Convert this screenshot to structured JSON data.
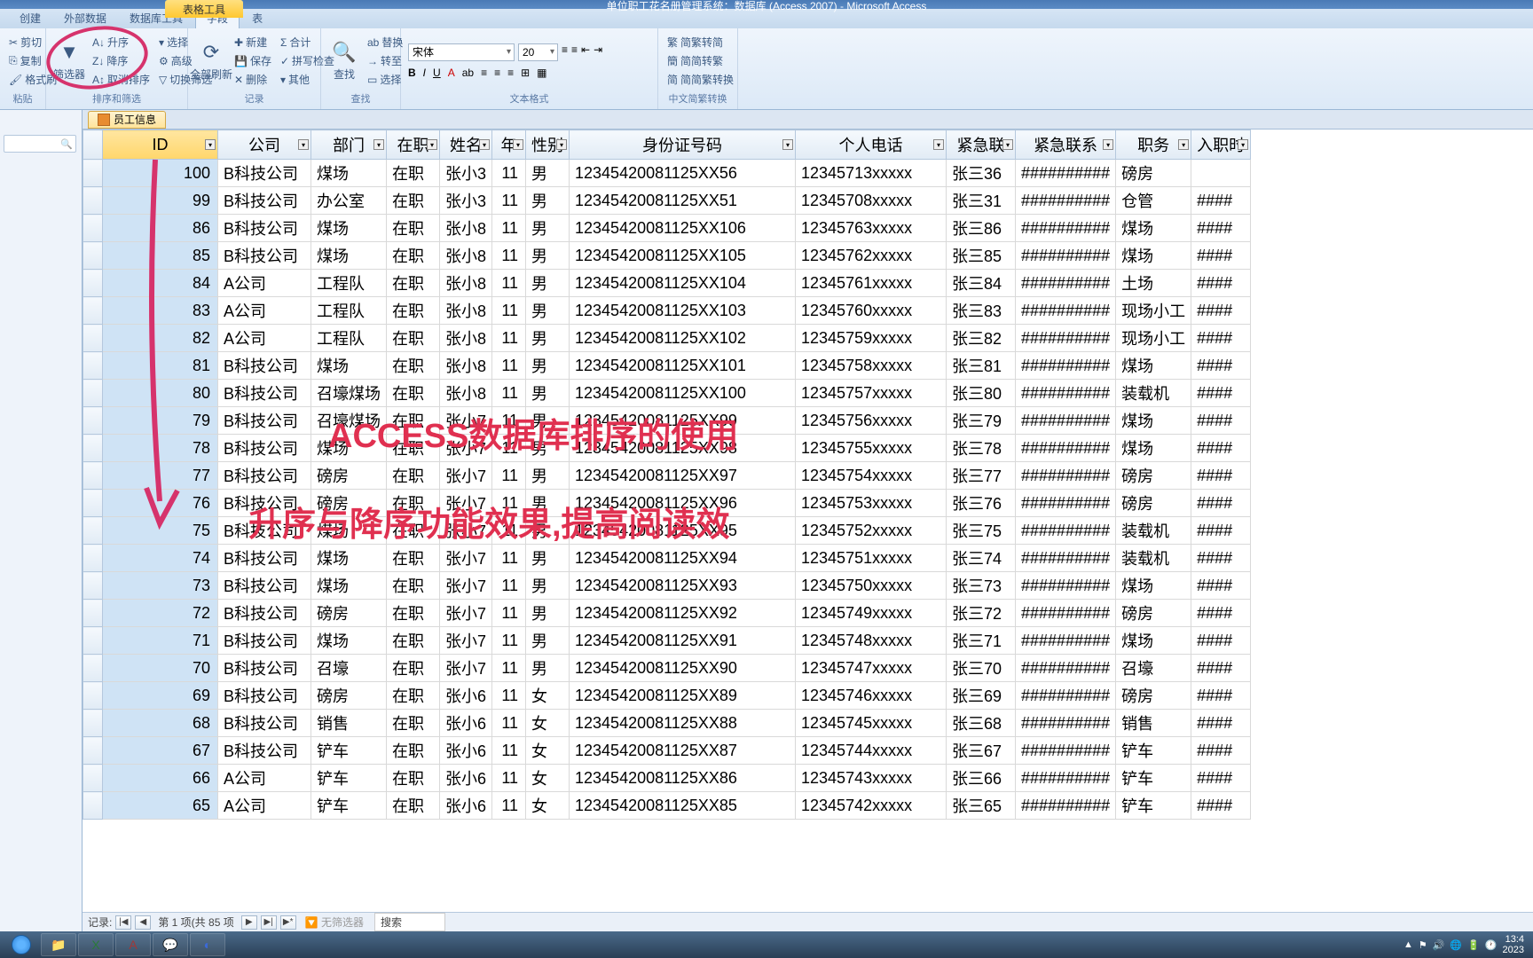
{
  "window": {
    "title": "单位职工花名册管理系统：数据库 (Access 2007) - Microsoft Access",
    "context_tab": "表格工具"
  },
  "ribbon_tabs": {
    "create": "创建",
    "external": "外部数据",
    "dbtools": "数据库工具",
    "fields": "字段",
    "table": "表"
  },
  "ribbon": {
    "clipboard": {
      "cut": "剪切",
      "copy": "复制",
      "format": "格式刷",
      "label": "粘贴"
    },
    "sort": {
      "asc": "升序",
      "desc": "降序",
      "clear": "取消排序",
      "filter": "筛选器",
      "select": "选择",
      "advanced": "高级",
      "toggle": "切换筛选",
      "label": "排序和筛选"
    },
    "records": {
      "refresh": "全部刷新",
      "new": "新建",
      "save": "保存",
      "delete": "删除",
      "totals": "合计",
      "spell": "拼写检查",
      "more": "其他",
      "label": "记录"
    },
    "find": {
      "find": "查找",
      "replace": "替换",
      "goto": "转至",
      "select": "选择",
      "label": "查找"
    },
    "textfmt": {
      "font": "宋体",
      "size": "20",
      "label": "文本格式"
    },
    "chs": {
      "a": "简繁转简",
      "b": "简简转繁",
      "c": "简简繁转换",
      "label": "中文简繁转换"
    }
  },
  "doc_tab": {
    "label": "员工信息"
  },
  "columns": {
    "id": "ID",
    "company": "公司",
    "dept": "部门",
    "status": "在职",
    "name": "姓名",
    "age": "年",
    "gender": "性别",
    "idcard": "身份证号码",
    "phone": "个人电话",
    "emerg": "紧急联",
    "emerg2": "紧急联系",
    "job": "职务",
    "hire": "入职时"
  },
  "rows": [
    {
      "id": 100,
      "company": "B科技公司",
      "dept": "煤场",
      "status": "在职",
      "name": "张小3",
      "age": 11,
      "gender": "男",
      "idcard": "12345420081125XX56",
      "phone": "12345713xxxxx",
      "emerg": "张三36",
      "job": "磅房",
      "h": ""
    },
    {
      "id": 99,
      "company": "B科技公司",
      "dept": "办公室",
      "status": "在职",
      "name": "张小3",
      "age": 11,
      "gender": "男",
      "idcard": "12345420081125XX51",
      "phone": "12345708xxxxx",
      "emerg": "张三31",
      "job": "仓管",
      "h": "####"
    },
    {
      "id": 86,
      "company": "B科技公司",
      "dept": "煤场",
      "status": "在职",
      "name": "张小8",
      "age": 11,
      "gender": "男",
      "idcard": "12345420081125XX106",
      "phone": "12345763xxxxx",
      "emerg": "张三86",
      "job": "煤场",
      "h": "####"
    },
    {
      "id": 85,
      "company": "B科技公司",
      "dept": "煤场",
      "status": "在职",
      "name": "张小8",
      "age": 11,
      "gender": "男",
      "idcard": "12345420081125XX105",
      "phone": "12345762xxxxx",
      "emerg": "张三85",
      "job": "煤场",
      "h": "####"
    },
    {
      "id": 84,
      "company": "A公司",
      "dept": "工程队",
      "status": "在职",
      "name": "张小8",
      "age": 11,
      "gender": "男",
      "idcard": "12345420081125XX104",
      "phone": "12345761xxxxx",
      "emerg": "张三84",
      "job": "土场",
      "h": "####"
    },
    {
      "id": 83,
      "company": "A公司",
      "dept": "工程队",
      "status": "在职",
      "name": "张小8",
      "age": 11,
      "gender": "男",
      "idcard": "12345420081125XX103",
      "phone": "12345760xxxxx",
      "emerg": "张三83",
      "job": "现场小工",
      "h": "####"
    },
    {
      "id": 82,
      "company": "A公司",
      "dept": "工程队",
      "status": "在职",
      "name": "张小8",
      "age": 11,
      "gender": "男",
      "idcard": "12345420081125XX102",
      "phone": "12345759xxxxx",
      "emerg": "张三82",
      "job": "现场小工",
      "h": "####"
    },
    {
      "id": 81,
      "company": "B科技公司",
      "dept": "煤场",
      "status": "在职",
      "name": "张小8",
      "age": 11,
      "gender": "男",
      "idcard": "12345420081125XX101",
      "phone": "12345758xxxxx",
      "emerg": "张三81",
      "job": "煤场",
      "h": "####"
    },
    {
      "id": 80,
      "company": "B科技公司",
      "dept": "召壕煤场",
      "status": "在职",
      "name": "张小8",
      "age": 11,
      "gender": "男",
      "idcard": "12345420081125XX100",
      "phone": "12345757xxxxx",
      "emerg": "张三80",
      "job": "装载机",
      "h": "####"
    },
    {
      "id": 79,
      "company": "B科技公司",
      "dept": "召壕煤场",
      "status": "在职",
      "name": "张小7",
      "age": 11,
      "gender": "男",
      "idcard": "12345420081125XX99",
      "phone": "12345756xxxxx",
      "emerg": "张三79",
      "job": "煤场",
      "h": "####"
    },
    {
      "id": 78,
      "company": "B科技公司",
      "dept": "煤场",
      "status": "在职",
      "name": "张小7",
      "age": 11,
      "gender": "男",
      "idcard": "12345420081125XX98",
      "phone": "12345755xxxxx",
      "emerg": "张三78",
      "job": "煤场",
      "h": "####"
    },
    {
      "id": 77,
      "company": "B科技公司",
      "dept": "磅房",
      "status": "在职",
      "name": "张小7",
      "age": 11,
      "gender": "男",
      "idcard": "12345420081125XX97",
      "phone": "12345754xxxxx",
      "emerg": "张三77",
      "job": "磅房",
      "h": "####"
    },
    {
      "id": 76,
      "company": "B科技公司",
      "dept": "磅房",
      "status": "在职",
      "name": "张小7",
      "age": 11,
      "gender": "男",
      "idcard": "12345420081125XX96",
      "phone": "12345753xxxxx",
      "emerg": "张三76",
      "job": "磅房",
      "h": "####"
    },
    {
      "id": 75,
      "company": "B科技公司",
      "dept": "煤场",
      "status": "在职",
      "name": "张小7",
      "age": 11,
      "gender": "男",
      "idcard": "12345420081125XX95",
      "phone": "12345752xxxxx",
      "emerg": "张三75",
      "job": "装载机",
      "h": "####"
    },
    {
      "id": 74,
      "company": "B科技公司",
      "dept": "煤场",
      "status": "在职",
      "name": "张小7",
      "age": 11,
      "gender": "男",
      "idcard": "12345420081125XX94",
      "phone": "12345751xxxxx",
      "emerg": "张三74",
      "job": "装载机",
      "h": "####"
    },
    {
      "id": 73,
      "company": "B科技公司",
      "dept": "煤场",
      "status": "在职",
      "name": "张小7",
      "age": 11,
      "gender": "男",
      "idcard": "12345420081125XX93",
      "phone": "12345750xxxxx",
      "emerg": "张三73",
      "job": "煤场",
      "h": "####"
    },
    {
      "id": 72,
      "company": "B科技公司",
      "dept": "磅房",
      "status": "在职",
      "name": "张小7",
      "age": 11,
      "gender": "男",
      "idcard": "12345420081125XX92",
      "phone": "12345749xxxxx",
      "emerg": "张三72",
      "job": "磅房",
      "h": "####"
    },
    {
      "id": 71,
      "company": "B科技公司",
      "dept": "煤场",
      "status": "在职",
      "name": "张小7",
      "age": 11,
      "gender": "男",
      "idcard": "12345420081125XX91",
      "phone": "12345748xxxxx",
      "emerg": "张三71",
      "job": "煤场",
      "h": "####"
    },
    {
      "id": 70,
      "company": "B科技公司",
      "dept": "召壕",
      "status": "在职",
      "name": "张小7",
      "age": 11,
      "gender": "男",
      "idcard": "12345420081125XX90",
      "phone": "12345747xxxxx",
      "emerg": "张三70",
      "job": "召壕",
      "h": "####"
    },
    {
      "id": 69,
      "company": "B科技公司",
      "dept": "磅房",
      "status": "在职",
      "name": "张小6",
      "age": 11,
      "gender": "女",
      "idcard": "12345420081125XX89",
      "phone": "12345746xxxxx",
      "emerg": "张三69",
      "job": "磅房",
      "h": "####"
    },
    {
      "id": 68,
      "company": "B科技公司",
      "dept": "销售",
      "status": "在职",
      "name": "张小6",
      "age": 11,
      "gender": "女",
      "idcard": "12345420081125XX88",
      "phone": "12345745xxxxx",
      "emerg": "张三68",
      "job": "销售",
      "h": "####"
    },
    {
      "id": 67,
      "company": "B科技公司",
      "dept": "铲车",
      "status": "在职",
      "name": "张小6",
      "age": 11,
      "gender": "女",
      "idcard": "12345420081125XX87",
      "phone": "12345744xxxxx",
      "emerg": "张三67",
      "job": "铲车",
      "h": "####"
    },
    {
      "id": 66,
      "company": "A公司",
      "dept": "铲车",
      "status": "在职",
      "name": "张小6",
      "age": 11,
      "gender": "女",
      "idcard": "12345420081125XX86",
      "phone": "12345743xxxxx",
      "emerg": "张三66",
      "job": "铲车",
      "h": "####"
    },
    {
      "id": 65,
      "company": "A公司",
      "dept": "铲车",
      "status": "在职",
      "name": "张小6",
      "age": 11,
      "gender": "女",
      "idcard": "12345420081125XX85",
      "phone": "12345742xxxxx",
      "emerg": "张三65",
      "job": "铲车",
      "h": "####"
    }
  ],
  "hash": "##########",
  "record_nav": {
    "label": "记录:",
    "pos": "第 1 项(共 85 项",
    "filter": "无筛选器",
    "search": "搜索"
  },
  "tray": {
    "time": "13:4",
    "date": "2023"
  },
  "annotations": {
    "line1": "ACCESS数据库排序的使用",
    "line2": "升序与降序功能效果,提高阅读效"
  }
}
